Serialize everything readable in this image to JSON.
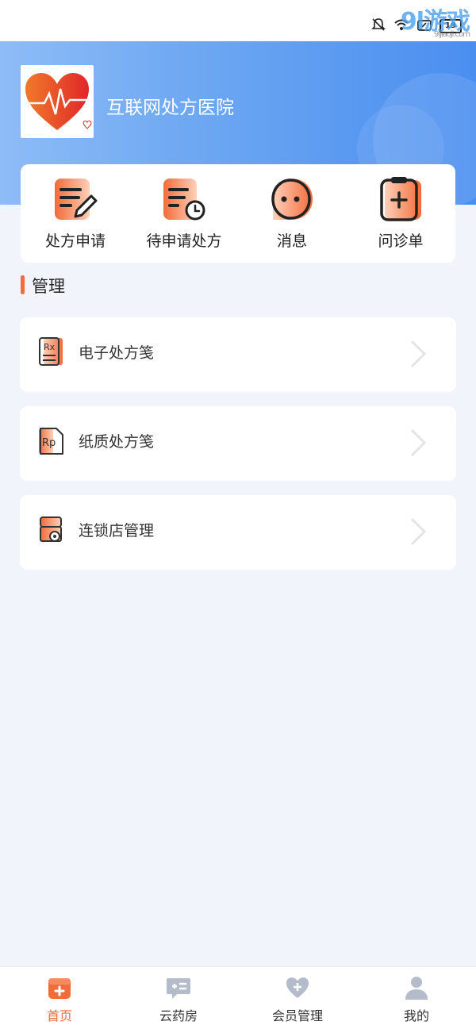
{
  "status_bar": {
    "battery": "19",
    "icons": [
      "bell-off-icon",
      "wifi-icon",
      "screen-icon",
      "battery-icon"
    ]
  },
  "watermark": {
    "brand": "9l游戏",
    "domain": "9ljiaoji.com"
  },
  "header": {
    "hospital_name": "互联网处方医院"
  },
  "quick_actions": [
    {
      "label": "处方申请",
      "icon": "prescription-edit-icon"
    },
    {
      "label": "待申请处方",
      "icon": "prescription-pending-icon"
    },
    {
      "label": "消息",
      "icon": "message-icon"
    },
    {
      "label": "问诊单",
      "icon": "consultation-form-icon"
    }
  ],
  "section": {
    "title": "管理"
  },
  "menu_items": [
    {
      "label": "电子处方笺",
      "icon": "rx-document-icon"
    },
    {
      "label": "纸质处方笺",
      "icon": "rp-paper-icon"
    },
    {
      "label": "连锁店管理",
      "icon": "store-settings-icon"
    }
  ],
  "tabs": [
    {
      "label": "首页",
      "icon": "home-icon",
      "active": true
    },
    {
      "label": "云药房",
      "icon": "pharmacy-icon",
      "active": false
    },
    {
      "label": "会员管理",
      "icon": "member-heart-icon",
      "active": false
    },
    {
      "label": "我的",
      "icon": "profile-icon",
      "active": false
    }
  ],
  "colors": {
    "accent": "#f26b3a",
    "banner": "#6ea8f2",
    "background": "#f1f4fa"
  }
}
